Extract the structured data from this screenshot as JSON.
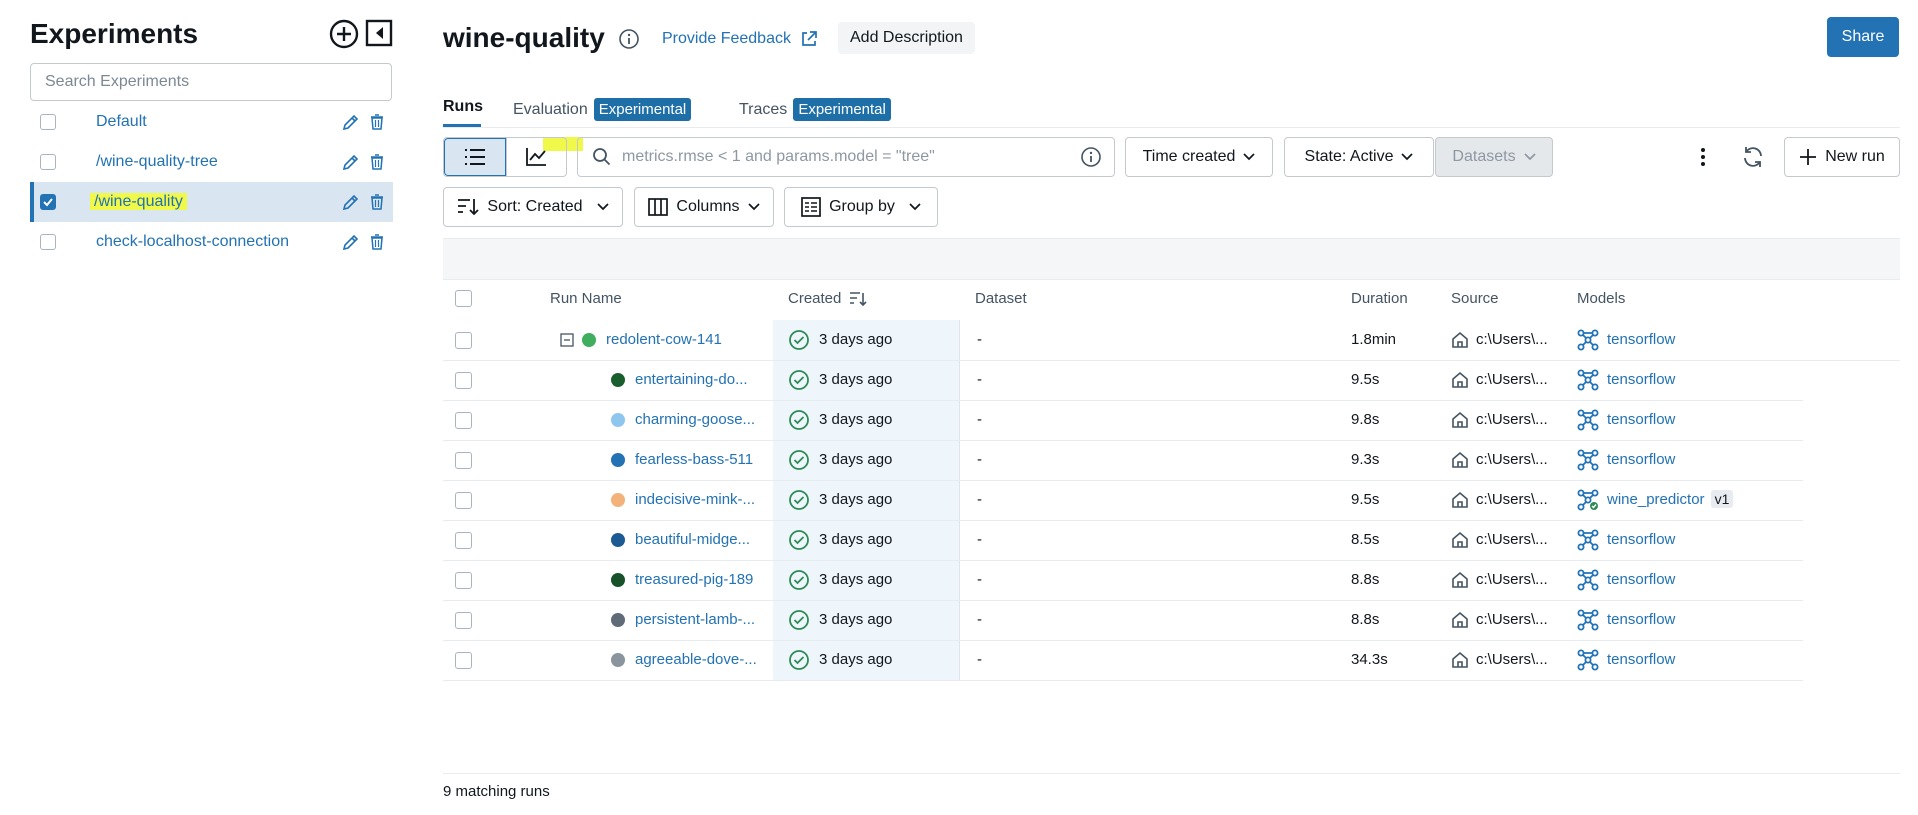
{
  "sidebar": {
    "title": "Experiments",
    "search_placeholder": "Search Experiments",
    "items": [
      {
        "label": "Default",
        "selected": false
      },
      {
        "label": "/wine-quality-tree",
        "selected": false
      },
      {
        "label": "/wine-quality",
        "selected": true
      },
      {
        "label": "check-localhost-connection",
        "selected": false
      }
    ]
  },
  "header": {
    "title": "wine-quality",
    "feedback_label": "Provide Feedback",
    "add_description_label": "Add Description",
    "share_label": "Share"
  },
  "tabs": [
    {
      "label": "Runs",
      "active": true
    },
    {
      "label": "Evaluation",
      "badge": "Experimental"
    },
    {
      "label": "Traces",
      "badge": "Experimental"
    }
  ],
  "toolbar": {
    "search_placeholder": "metrics.rmse < 1 and params.model = \"tree\"",
    "time_created_label": "Time created",
    "state_label": "State: Active",
    "datasets_label": "Datasets",
    "new_run_label": "New run",
    "sort_label": "Sort: Created",
    "columns_label": "Columns",
    "group_by_label": "Group by"
  },
  "table": {
    "headers": {
      "run_name": "Run Name",
      "created": "Created",
      "dataset": "Dataset",
      "duration": "Duration",
      "source": "Source",
      "models": "Models"
    },
    "rows": [
      {
        "name": "redolent-cow-141",
        "color": "#3fae5e",
        "created": "3 days ago",
        "dataset": "-",
        "duration": "1.8min",
        "source": "c:\\Users\\...",
        "model": "tensorflow",
        "parent": true
      },
      {
        "name": "entertaining-do...",
        "color": "#1b5e2e",
        "created": "3 days ago",
        "dataset": "-",
        "duration": "9.5s",
        "source": "c:\\Users\\...",
        "model": "tensorflow"
      },
      {
        "name": "charming-goose...",
        "color": "#8fc6ee",
        "created": "3 days ago",
        "dataset": "-",
        "duration": "9.8s",
        "source": "c:\\Users\\...",
        "model": "tensorflow"
      },
      {
        "name": "fearless-bass-511",
        "color": "#2272b4",
        "created": "3 days ago",
        "dataset": "-",
        "duration": "9.3s",
        "source": "c:\\Users\\...",
        "model": "tensorflow"
      },
      {
        "name": "indecisive-mink-...",
        "color": "#f2b27a",
        "created": "3 days ago",
        "dataset": "-",
        "duration": "9.5s",
        "source": "c:\\Users\\...",
        "model": "wine_predictor",
        "model_version": "v1"
      },
      {
        "name": "beautiful-midge...",
        "color": "#1c5a94",
        "created": "3 days ago",
        "dataset": "-",
        "duration": "8.5s",
        "source": "c:\\Users\\...",
        "model": "tensorflow"
      },
      {
        "name": "treasured-pig-189",
        "color": "#16512a",
        "created": "3 days ago",
        "dataset": "-",
        "duration": "8.8s",
        "source": "c:\\Users\\...",
        "model": "tensorflow"
      },
      {
        "name": "persistent-lamb-...",
        "color": "#5f6b77",
        "created": "3 days ago",
        "dataset": "-",
        "duration": "8.8s",
        "source": "c:\\Users\\...",
        "model": "tensorflow"
      },
      {
        "name": "agreeable-dove-...",
        "color": "#8a949e",
        "created": "3 days ago",
        "dataset": "-",
        "duration": "34.3s",
        "source": "c:\\Users\\...",
        "model": "tensorflow"
      }
    ]
  },
  "footer": {
    "matching_runs": "9 matching runs"
  },
  "colors": {
    "accent": "#2272b4",
    "highlight": "#f0f84a",
    "success": "#2e8b57"
  }
}
